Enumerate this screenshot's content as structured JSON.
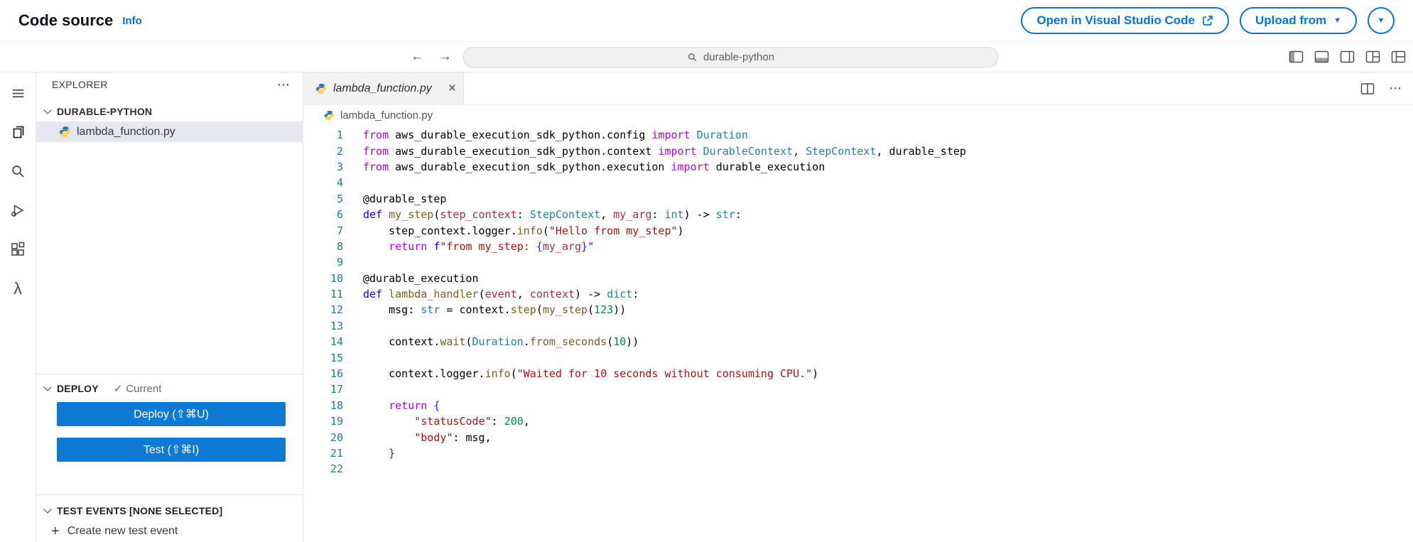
{
  "colors": {
    "accent": "#0972d3",
    "info_link": "#006ce0",
    "deploy_button_bg": "#0e7ad3",
    "selected_file_bg": "#e4e6f1",
    "line_number": "#237893",
    "tok_kw": "#af00db",
    "tok_df": "#0000ff",
    "tok_fn": "#795e26",
    "tok_ty": "#267f99",
    "tok_st": "#a31515",
    "tok_nu": "#098658",
    "tok_pr": "#9d3039",
    "tok_pl": "#000000",
    "tok_br": "#0431fa"
  },
  "icons": {
    "back_arrow": "←",
    "forward_arrow": "→",
    "caret_down": "▼",
    "close": "×",
    "more": "⋯",
    "check": "✓",
    "plus": "+",
    "lambda": "λ"
  },
  "header": {
    "title": "Code source",
    "info": "Info",
    "open_vsc": "Open in Visual Studio Code",
    "upload_from": "Upload from"
  },
  "topbar": {
    "search": "durable-python"
  },
  "sidebar": {
    "explorer_title": "EXPLORER",
    "workspace": "DURABLE-PYTHON",
    "file": "lambda_function.py",
    "deploy": {
      "title": "DEPLOY",
      "status": "Current",
      "deploy_label": "Deploy (⇧⌘U)",
      "test_label": "Test (⇧⌘I)"
    },
    "test_events": {
      "title": "TEST EVENTS [NONE SELECTED]",
      "create": "Create new test event"
    }
  },
  "editor": {
    "tab": "lambda_function.py",
    "breadcrumb": "lambda_function.py",
    "lines": [
      [
        [
          "from ",
          "kw"
        ],
        [
          "aws_durable_execution_sdk_python.config ",
          "pl"
        ],
        [
          "import ",
          "kw"
        ],
        [
          "Duration",
          "ty"
        ]
      ],
      [
        [
          "from ",
          "kw"
        ],
        [
          "aws_durable_execution_sdk_python.context ",
          "pl"
        ],
        [
          "import ",
          "kw"
        ],
        [
          "DurableContext",
          "ty"
        ],
        [
          ", ",
          "pl"
        ],
        [
          "StepContext",
          "ty"
        ],
        [
          ", ",
          "pl"
        ],
        [
          "durable_step",
          "pl"
        ]
      ],
      [
        [
          "from ",
          "kw"
        ],
        [
          "aws_durable_execution_sdk_python.execution ",
          "pl"
        ],
        [
          "import ",
          "kw"
        ],
        [
          "durable_execution",
          "pl"
        ]
      ],
      [],
      [
        [
          "@durable_step",
          "pl"
        ]
      ],
      [
        [
          "def ",
          "df"
        ],
        [
          "my_step",
          "fn"
        ],
        [
          "(",
          "pl"
        ],
        [
          "step_context",
          "pr"
        ],
        [
          ": ",
          "pl"
        ],
        [
          "StepContext",
          "ty"
        ],
        [
          ", ",
          "pl"
        ],
        [
          "my_arg",
          "pr"
        ],
        [
          ": ",
          "pl"
        ],
        [
          "int",
          "ty"
        ],
        [
          ") -> ",
          "pl"
        ],
        [
          "str",
          "ty"
        ],
        [
          ":",
          "pl"
        ]
      ],
      [
        [
          "    step_context.logger.",
          "pl"
        ],
        [
          "info",
          "fn"
        ],
        [
          "(",
          "pl"
        ],
        [
          "\"Hello from my_step\"",
          "st"
        ],
        [
          ")",
          "pl"
        ]
      ],
      [
        [
          "    return ",
          "kw"
        ],
        [
          "f",
          "df"
        ],
        [
          "\"from my_step: ",
          "st"
        ],
        [
          "{",
          "br"
        ],
        [
          "my_arg",
          "pr"
        ],
        [
          "}",
          "br"
        ],
        [
          "\"",
          "st"
        ]
      ],
      [],
      [
        [
          "@durable_execution",
          "pl"
        ]
      ],
      [
        [
          "def ",
          "df"
        ],
        [
          "lambda_handler",
          "fn"
        ],
        [
          "(",
          "pl"
        ],
        [
          "event",
          "pr"
        ],
        [
          ", ",
          "pl"
        ],
        [
          "context",
          "pr"
        ],
        [
          ") -> ",
          "pl"
        ],
        [
          "dict",
          "ty"
        ],
        [
          ":",
          "pl"
        ]
      ],
      [
        [
          "    msg",
          "pl"
        ],
        [
          ": ",
          "pl"
        ],
        [
          "str",
          "ty"
        ],
        [
          " = context.",
          "pl"
        ],
        [
          "step",
          "fn"
        ],
        [
          "(",
          "pl"
        ],
        [
          "my_step",
          "fn"
        ],
        [
          "(",
          "pl"
        ],
        [
          "123",
          "nu"
        ],
        [
          "))",
          "pl"
        ]
      ],
      [],
      [
        [
          "    context.",
          "pl"
        ],
        [
          "wait",
          "fn"
        ],
        [
          "(",
          "pl"
        ],
        [
          "Duration",
          "ty"
        ],
        [
          ".",
          "pl"
        ],
        [
          "from_seconds",
          "fn"
        ],
        [
          "(",
          "pl"
        ],
        [
          "10",
          "nu"
        ],
        [
          "))",
          "pl"
        ]
      ],
      [],
      [
        [
          "    context.logger.",
          "pl"
        ],
        [
          "info",
          "fn"
        ],
        [
          "(",
          "pl"
        ],
        [
          "\"Waited for 10 seconds without consuming CPU.\"",
          "st"
        ],
        [
          ")",
          "pl"
        ]
      ],
      [],
      [
        [
          "    return ",
          "kw"
        ],
        [
          "{",
          "br"
        ]
      ],
      [
        [
          "        \"statusCode\"",
          "st"
        ],
        [
          ": ",
          "pl"
        ],
        [
          "200",
          "nu"
        ],
        [
          ",",
          "pl"
        ]
      ],
      [
        [
          "        \"body\"",
          "st"
        ],
        [
          ": ",
          "pl"
        ],
        [
          "msg",
          "pl"
        ],
        [
          ",",
          "pl"
        ]
      ],
      [
        [
          "    }",
          "br"
        ]
      ],
      []
    ]
  }
}
